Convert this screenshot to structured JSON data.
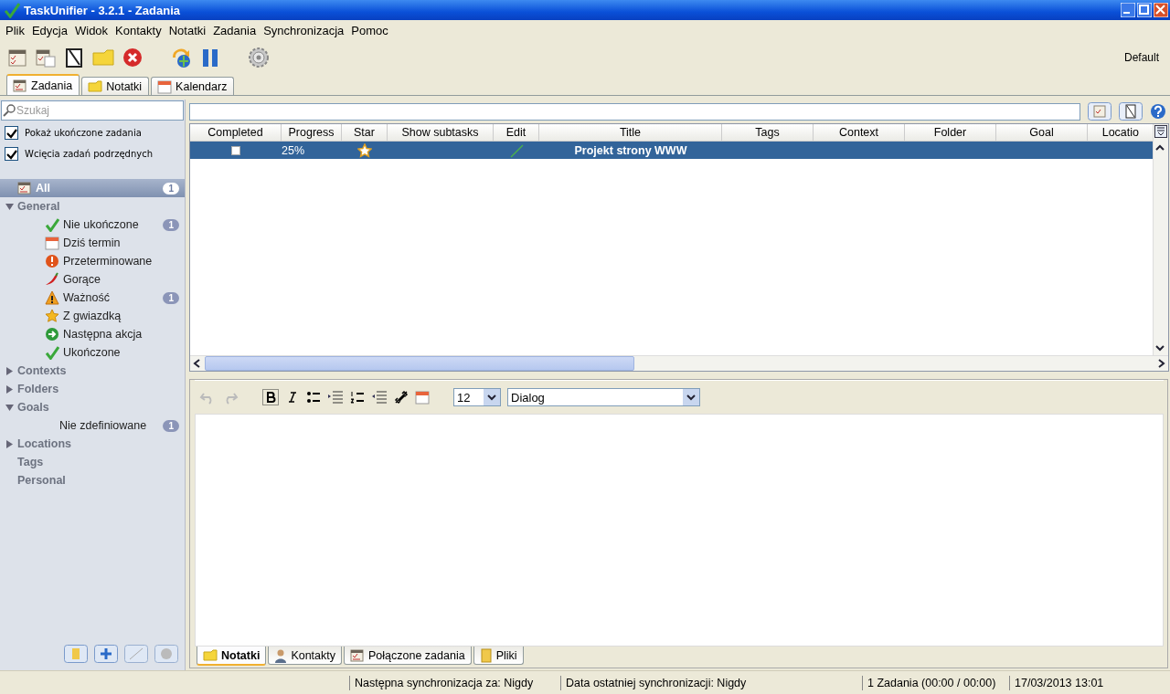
{
  "window": {
    "title": "TaskUnifier - 3.2.1 - Zadania"
  },
  "menu": [
    "Plik",
    "Edycja",
    "Widok",
    "Kontakty",
    "Notatki",
    "Zadania",
    "Synchronizacja",
    "Pomoc"
  ],
  "profile": "Default",
  "tabs": [
    {
      "label": "Zadania",
      "selected": true
    },
    {
      "label": "Notatki",
      "selected": false
    },
    {
      "label": "Kalendarz",
      "selected": false
    }
  ],
  "sidebar": {
    "search": {
      "placeholder": "Szukaj"
    },
    "options": [
      {
        "label": "Pokaż ukończone zadania",
        "checked": true
      },
      {
        "label": "Wcięcia zadań podrzędnych",
        "checked": true
      }
    ],
    "tree": [
      {
        "label": "All",
        "count": "1",
        "selected": true
      },
      {
        "label": "General",
        "expanded": true,
        "selected": false,
        "children": [
          {
            "label": "Nie ukończone",
            "count": "1",
            "selected": false
          },
          {
            "label": "Dziś termin",
            "selected": false
          },
          {
            "label": "Przeterminowane",
            "selected": false
          },
          {
            "label": "Gorące",
            "selected": false
          },
          {
            "label": "Ważność",
            "count": "1",
            "selected": false
          },
          {
            "label": "Z gwiazdką",
            "selected": false
          },
          {
            "label": "Następna akcja",
            "selected": false
          },
          {
            "label": "Ukończone",
            "selected": false
          }
        ]
      },
      {
        "label": "Contexts",
        "expanded": false,
        "selected": false
      },
      {
        "label": "Folders",
        "expanded": false,
        "selected": false
      },
      {
        "label": "Goals",
        "expanded": true,
        "selected": false,
        "children": [
          {
            "label": "Nie zdefiniowane",
            "count": "1",
            "selected": false
          }
        ]
      },
      {
        "label": "Locations",
        "expanded": false,
        "selected": false
      },
      {
        "label": "Tags",
        "selected": false
      },
      {
        "label": "Personal",
        "selected": false
      }
    ]
  },
  "table": {
    "columns": [
      "Completed",
      "Progress",
      "Star",
      "Show subtasks",
      "Edit",
      "Title",
      "Tags",
      "Context",
      "Folder",
      "Goal",
      "Locatio"
    ],
    "rows": [
      {
        "selected": true,
        "completed": false,
        "progress": "25%",
        "starred": true,
        "title": "Projekt strony WWW"
      }
    ]
  },
  "editor": {
    "font_size": "12",
    "font": "Dialog"
  },
  "bottom_tabs": [
    {
      "label": "Notatki",
      "selected": true
    },
    {
      "label": "Kontakty",
      "selected": false
    },
    {
      "label": "Połączone zadania",
      "selected": false
    },
    {
      "label": "Pliki",
      "selected": false
    }
  ],
  "status_bar": [
    "Następna synchronizacja za: Nigdy",
    "Data ostatniej synchronizacji: Nigdy",
    "1 Zadania (00:00 / 00:00)",
    "17/03/2013 13:01"
  ]
}
